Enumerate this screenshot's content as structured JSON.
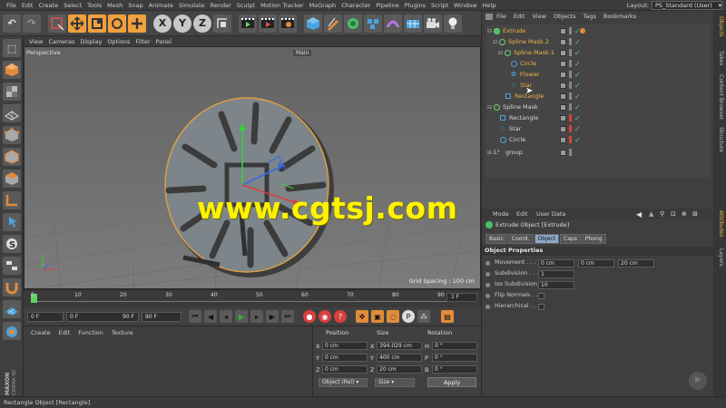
{
  "menubar": {
    "items": [
      "File",
      "Edit",
      "Create",
      "Select",
      "Tools",
      "Mesh",
      "Snap",
      "Animate",
      "Simulate",
      "Render",
      "Sculpt",
      "Motion Tracker",
      "MoGraph",
      "Character",
      "Pipeline",
      "Plugins",
      "Script",
      "Window",
      "Help"
    ],
    "layout_label": "Layout:",
    "layout_value": "PS_Standard (User)"
  },
  "viewport": {
    "menu": [
      "View",
      "Cameras",
      "Display",
      "Options",
      "Filter",
      "Panel"
    ],
    "camera_label": "Perspective",
    "main_tab": "Main",
    "grid_spacing": "Grid Spacing : 100 cm",
    "watermark": "www.cgtsj.com"
  },
  "timeline": {
    "ticks": [
      "0",
      "10",
      "20",
      "30",
      "40",
      "50",
      "60",
      "70",
      "80",
      "90"
    ],
    "current_frame": "1 F"
  },
  "transport": {
    "start": "0 F",
    "preview_start": "0 F",
    "preview_end": "90 F",
    "end": "90 F"
  },
  "material_panel": {
    "menu": [
      "Create",
      "Edit",
      "Function",
      "Texture"
    ]
  },
  "coords": {
    "position_header": "Position",
    "size_header": "Size",
    "rotation_header": "Rotation",
    "rows": [
      {
        "axis": "X",
        "pos": "0 cm",
        "size_axis": "X",
        "size": "394.029 cm",
        "rot_axis": "H",
        "rot": "0 °"
      },
      {
        "axis": "Y",
        "pos": "0 cm",
        "size_axis": "Y",
        "size": "400 cm",
        "rot_axis": "P",
        "rot": "0 °"
      },
      {
        "axis": "Z",
        "pos": "0 cm",
        "size_axis": "Z",
        "size": "20 cm",
        "rot_axis": "B",
        "rot": "0 °"
      }
    ],
    "mode_select": "Object (Rel)",
    "size_select": "Size",
    "apply_label": "Apply"
  },
  "objects": {
    "menu": [
      "File",
      "Edit",
      "View",
      "Objects",
      "Tags",
      "Bookmarks"
    ],
    "tree": [
      {
        "name": "Extrude",
        "depth": 0,
        "color": "#f0b24a"
      },
      {
        "name": "Spline Mask.2",
        "depth": 1,
        "color": "#f0b24a"
      },
      {
        "name": "Spline Mask.1",
        "depth": 2,
        "color": "#f0b24a"
      },
      {
        "name": "Circle",
        "depth": 3,
        "color": "#f0b24a"
      },
      {
        "name": "Flower",
        "depth": 3,
        "color": "#f0b24a"
      },
      {
        "name": "Star",
        "depth": 3,
        "color": "#f0b24a"
      },
      {
        "name": "Rectangle",
        "depth": 2,
        "color": "#f0b24a"
      },
      {
        "name": "Spline Mask",
        "depth": 0,
        "color": "#d6d6d6"
      },
      {
        "name": "Rectangle",
        "depth": 1,
        "color": "#d6d6d6"
      },
      {
        "name": "Star",
        "depth": 1,
        "color": "#d6d6d6"
      },
      {
        "name": "Circle",
        "depth": 1,
        "color": "#d6d6d6"
      },
      {
        "name": "group",
        "depth": 0,
        "color": "#d6d6d6"
      }
    ]
  },
  "attributes": {
    "menu": [
      "Mode",
      "Edit",
      "User Data"
    ],
    "title": "Extrude Object [Extrude]",
    "tabs": [
      "Basic",
      "Coord.",
      "Object",
      "Caps",
      "Phong"
    ],
    "active_tab": "Object",
    "section": "Object Properties",
    "movement_label": "Movement . . . .",
    "movement": [
      "0 cm",
      "0 cm",
      "20 cm"
    ],
    "subdivision_label": "Subdivision . . .",
    "subdivision": "1",
    "iso_label": "Iso Subdivision",
    "iso": "10",
    "flip_label": "Flip Normals . . .",
    "hier_label": "Hierarchical . . ."
  },
  "side_tabs": [
    "Objects",
    "Takes",
    "Content Browser",
    "Structure",
    "Attributes",
    "Layers"
  ],
  "status": {
    "text": "Rectangle Object [Rectangle]"
  },
  "brand": {
    "line1": "MAXON",
    "line2": "CINEMA 4D"
  }
}
